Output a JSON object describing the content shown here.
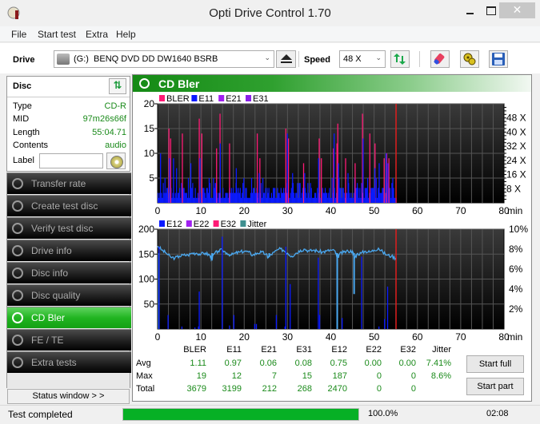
{
  "window": {
    "title": "Opti Drive Control 1.70",
    "close_glyph": "✕"
  },
  "menu": [
    "File",
    "Start test",
    "Extra",
    "Help"
  ],
  "toolbar": {
    "drive_label": "Drive",
    "drive_value": "(G:)  BENQ DVD DD DW1640 BSRB",
    "speed_label": "Speed",
    "speed_value": "48 X",
    "dd_arrow": "⌄",
    "icons": [
      "eject-icon",
      "refresh-icon",
      "eraser-icon",
      "settings-icon",
      "save-icon"
    ]
  },
  "disc": {
    "title": "Disc",
    "refresh_glyph": "⇅",
    "fields": [
      {
        "label": "Type",
        "value": "CD-R"
      },
      {
        "label": "MID",
        "value": "97m26s66f"
      },
      {
        "label": "Length",
        "value": "55:04.71"
      },
      {
        "label": "Contents",
        "value": "audio"
      }
    ],
    "label_field": {
      "label": "Label",
      "value": ""
    }
  },
  "nav": [
    {
      "label": "Transfer rate",
      "active": false
    },
    {
      "label": "Create test disc",
      "active": false
    },
    {
      "label": "Verify test disc",
      "active": false
    },
    {
      "label": "Drive info",
      "active": false
    },
    {
      "label": "Disc info",
      "active": false
    },
    {
      "label": "Disc quality",
      "active": false
    },
    {
      "label": "CD Bler",
      "active": true
    },
    {
      "label": "FE / TE",
      "active": false
    },
    {
      "label": "Extra tests",
      "active": false
    }
  ],
  "status_window_button": "Status window > >",
  "panel": {
    "title": "CD Bler"
  },
  "chart_data": [
    {
      "type": "bar",
      "title": "CD Bler (upper)",
      "legend": [
        {
          "name": "BLER",
          "color": "#ff1a75"
        },
        {
          "name": "E11",
          "color": "#0a1aff"
        },
        {
          "name": "E21",
          "color": "#a020f0"
        },
        {
          "name": "E31",
          "color": "#8a20e8"
        }
      ],
      "xlim": [
        0,
        80
      ],
      "xlabel": "min",
      "x_ticks": [
        0,
        10,
        20,
        30,
        40,
        50,
        60,
        70,
        80
      ],
      "ylim": [
        0,
        20
      ],
      "y_ticks": [
        5,
        10,
        15,
        20
      ],
      "y2_ticks": [
        "8 X",
        "16 X",
        "24 X",
        "32 X",
        "40 X",
        "48 X"
      ],
      "y2lim": [
        0,
        56
      ],
      "end_marker_min": 55.08,
      "bler_spikes": [
        [
          2.5,
          15
        ],
        [
          2.9,
          13
        ],
        [
          5.6,
          14
        ],
        [
          9.5,
          17
        ],
        [
          10.1,
          14
        ],
        [
          14.3,
          18
        ],
        [
          16.5,
          12
        ],
        [
          13.5,
          11
        ],
        [
          22.9,
          14
        ],
        [
          23.5,
          9
        ],
        [
          29.5,
          15
        ],
        [
          30.1,
          13
        ],
        [
          33.6,
          8
        ],
        [
          37.2,
          13
        ],
        [
          37.7,
          9
        ],
        [
          40.5,
          11
        ],
        [
          41.3,
          12
        ],
        [
          41.5,
          16
        ],
        [
          43.3,
          9
        ],
        [
          45.5,
          8
        ],
        [
          47.2,
          18
        ],
        [
          48.9,
          14
        ],
        [
          50.1,
          12
        ],
        [
          52.2,
          9
        ],
        [
          52.8,
          10
        ],
        [
          53.3,
          9
        ]
      ],
      "e11_peaks": [
        [
          0.5,
          10
        ],
        [
          2.6,
          9
        ],
        [
          3.5,
          9
        ],
        [
          4.2,
          7
        ],
        [
          7.5,
          8
        ],
        [
          9.6,
          9
        ],
        [
          14.3,
          12
        ],
        [
          18,
          7
        ],
        [
          23.3,
          6
        ],
        [
          29.8,
          14
        ],
        [
          31,
          6
        ],
        [
          33.8,
          6
        ],
        [
          37,
          9
        ],
        [
          40.6,
          14
        ],
        [
          41.6,
          8
        ],
        [
          43.8,
          6
        ],
        [
          47.3,
          13
        ],
        [
          50,
          7
        ],
        [
          51,
          8
        ],
        [
          52.6,
          10
        ],
        [
          53,
          8
        ]
      ],
      "e11_base": 3
    },
    {
      "type": "line",
      "title": "CD Bler (lower)",
      "legend": [
        {
          "name": "E12",
          "color": "#0a1aff"
        },
        {
          "name": "E22",
          "color": "#a020f0"
        },
        {
          "name": "E32",
          "color": "#ff1a75"
        },
        {
          "name": "Jitter",
          "color": "#3f8f8f"
        }
      ],
      "xlim": [
        0,
        80
      ],
      "xlabel": "min",
      "x_ticks": [
        0,
        10,
        20,
        30,
        40,
        50,
        60,
        70,
        80
      ],
      "ylim": [
        0,
        200
      ],
      "y_ticks": [
        50,
        100,
        150,
        200
      ],
      "y2lim": [
        0,
        10
      ],
      "y2_ticks": [
        "2%",
        "4%",
        "6%",
        "8%",
        "10%"
      ],
      "end_marker_min": 55.08,
      "e12_spikes": [
        [
          0.2,
          165
        ],
        [
          2.3,
          28
        ],
        [
          5.5,
          5
        ],
        [
          8.5,
          3
        ],
        [
          9.5,
          75
        ],
        [
          9.3,
          5
        ],
        [
          14.8,
          185
        ],
        [
          16.5,
          7
        ],
        [
          17.5,
          28
        ],
        [
          22.3,
          10
        ],
        [
          22.7,
          10
        ],
        [
          27.3,
          28
        ],
        [
          29.3,
          5
        ],
        [
          29.5,
          165
        ],
        [
          30.5,
          90
        ],
        [
          37,
          143
        ],
        [
          37.3,
          28
        ],
        [
          42.5,
          22
        ],
        [
          47,
          145
        ],
        [
          51,
          5
        ],
        [
          52.3,
          20
        ],
        [
          53,
          85
        ]
      ],
      "jitter_pct": [
        [
          0,
          8.3
        ],
        [
          1,
          7.9
        ],
        [
          2,
          7.6
        ],
        [
          3,
          7.2
        ],
        [
          4,
          7.1
        ],
        [
          5,
          7.3
        ],
        [
          6,
          7.4
        ],
        [
          7,
          7.4
        ],
        [
          8,
          7.6
        ],
        [
          9,
          7.6
        ],
        [
          10,
          7.5
        ],
        [
          11,
          7.6
        ],
        [
          12,
          7.4
        ],
        [
          12.5,
          7.0
        ],
        [
          13,
          7.5
        ],
        [
          14,
          7.8
        ],
        [
          15,
          7.9
        ],
        [
          16,
          7.6
        ],
        [
          17,
          7.4
        ],
        [
          18,
          7.6
        ],
        [
          19,
          7.7
        ],
        [
          20,
          7.8
        ],
        [
          21,
          7.7
        ],
        [
          22,
          7.4
        ],
        [
          23,
          7.6
        ],
        [
          24,
          7.7
        ],
        [
          25,
          7.5
        ],
        [
          25.5,
          7.2
        ],
        [
          26,
          7.4
        ],
        [
          27,
          7.7
        ],
        [
          28,
          8.0
        ],
        [
          29,
          7.9
        ],
        [
          30,
          7.6
        ],
        [
          31,
          7.3
        ],
        [
          32,
          7.6
        ],
        [
          33,
          7.9
        ],
        [
          34,
          8.0
        ],
        [
          35,
          7.8
        ],
        [
          36,
          7.9
        ],
        [
          37,
          7.8
        ],
        [
          38,
          7.7
        ],
        [
          39,
          7.8
        ],
        [
          40,
          7.9
        ],
        [
          41,
          7.8
        ],
        [
          41.5,
          7.0
        ],
        [
          42,
          7.5
        ],
        [
          43,
          7.7
        ],
        [
          44,
          7.8
        ],
        [
          45,
          7.8
        ],
        [
          45.5,
          7.1
        ],
        [
          46,
          7.5
        ],
        [
          47,
          7.6
        ],
        [
          48,
          7.8
        ],
        [
          49,
          7.7
        ],
        [
          50,
          7.9
        ],
        [
          51,
          8.1
        ],
        [
          52,
          7.7
        ],
        [
          53,
          7.4
        ],
        [
          54,
          7.3
        ],
        [
          55,
          7.1
        ]
      ],
      "jitter_dips": [
        [
          0.1,
          0
        ],
        [
          12.4,
          7.0
        ],
        [
          25.6,
          7.2
        ],
        [
          41.3,
          0
        ],
        [
          45.2,
          3.5
        ]
      ]
    }
  ],
  "stats": {
    "columns": [
      "BLER",
      "E11",
      "E21",
      "E31",
      "E12",
      "E22",
      "E32",
      "Jitter"
    ],
    "rows": [
      {
        "label": "Avg",
        "values": [
          "1.11",
          "0.97",
          "0.06",
          "0.08",
          "0.75",
          "0.00",
          "0.00",
          "7.41%"
        ]
      },
      {
        "label": "Max",
        "values": [
          "19",
          "12",
          "7",
          "15",
          "187",
          "0",
          "0",
          "8.6%"
        ]
      },
      {
        "label": "Total",
        "values": [
          "3679",
          "3199",
          "212",
          "268",
          "2470",
          "0",
          "0",
          ""
        ]
      }
    ]
  },
  "buttons": {
    "start_full": "Start full",
    "start_part": "Start part"
  },
  "statusbar": {
    "text": "Test completed",
    "progress": 100.0,
    "progress_label": "100.0%",
    "elapsed": "02:08"
  }
}
